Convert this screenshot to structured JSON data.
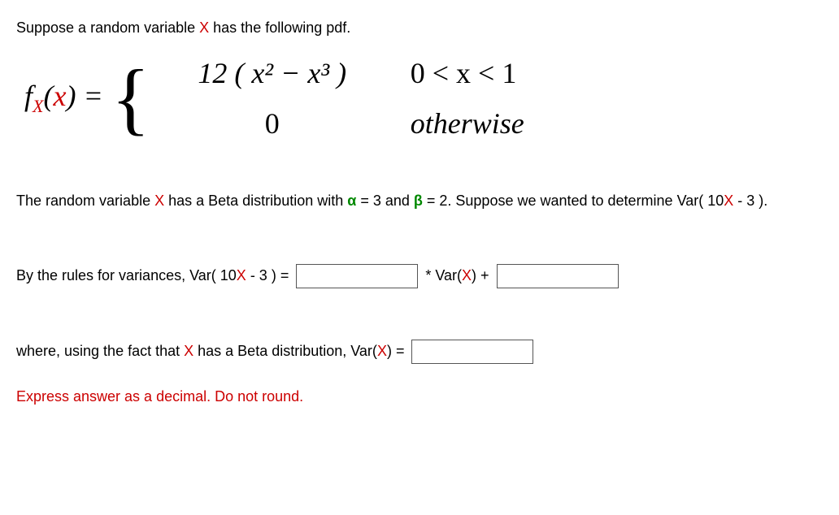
{
  "intro": {
    "part1": "Suppose a random variable ",
    "xvar": "X",
    "part2": " has the following pdf."
  },
  "math": {
    "fx_f": "f",
    "fx_sub": "X",
    "fx_open": "(",
    "fx_x": "x",
    "fx_close": ") = ",
    "case1_left": "12 ( x² − x³ )",
    "case1_right": "0 < x < 1",
    "case2_left": "0",
    "case2_right": "otherwise"
  },
  "para2": {
    "p1": "The random variable ",
    "xvar": "X",
    "p2": " has a Beta distribution with ",
    "alpha": "α",
    "p3": " = 3 and ",
    "beta": "β",
    "p4": " = 2.  Suppose we wanted to determine Var( 10",
    "xvar2": "X",
    "p5": " - 3 )."
  },
  "line3": {
    "p1": "By the rules for variances, Var( 10",
    "xvar": "X",
    "p2": " - 3 ) = ",
    "p3": " * Var(",
    "xvar2": "X",
    "p4": ") + "
  },
  "line4": {
    "p1": "where, using the fact that ",
    "xvar": "X",
    "p2": " has a Beta distribution, Var(",
    "xvar2": "X",
    "p3": ") = "
  },
  "line5": "Express answer as a decimal.  Do not round."
}
